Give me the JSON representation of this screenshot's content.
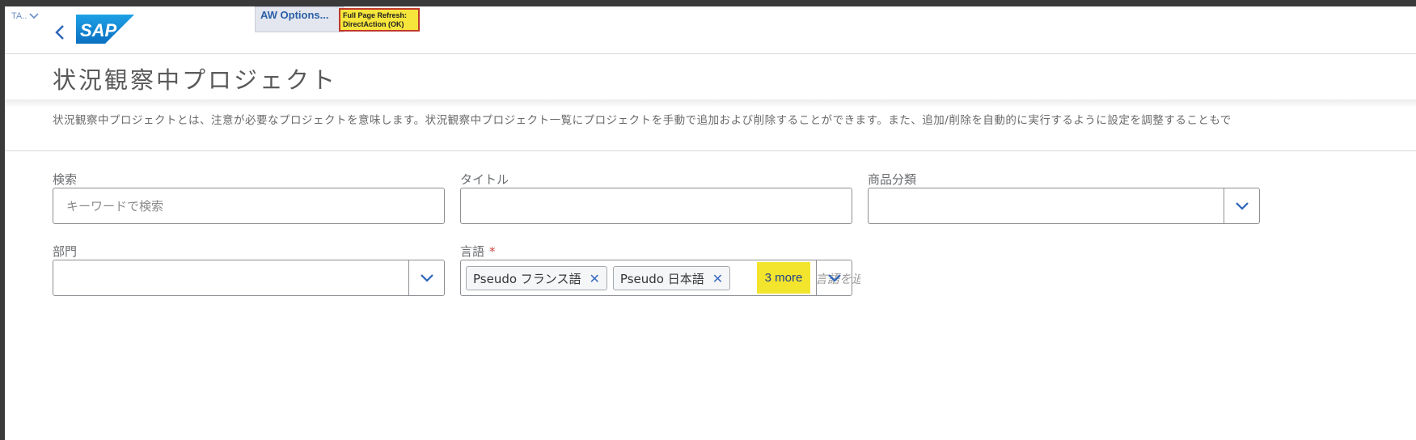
{
  "header": {
    "ta_menu_label": "TA..",
    "aw_options_label": "AW Options...",
    "refresh_badge_line1": "Full Page Refresh:",
    "refresh_badge_line2": "DirectAction (OK)",
    "logo_text": "SAP"
  },
  "page": {
    "title": "状況観察中プロジェクト",
    "description": "状況観察中プロジェクトとは、注意が必要なプロジェクトを意味します。状況観察中プロジェクト一覧にプロジェクトを手動で追加および削除することができます。また、追加/削除を自動的に実行するように設定を調整することもで"
  },
  "form": {
    "search": {
      "label": "検索",
      "placeholder": "キーワードで検索",
      "value": ""
    },
    "title": {
      "label": "タイトル",
      "value": ""
    },
    "product_category": {
      "label": "商品分類",
      "value": ""
    },
    "department": {
      "label": "部門",
      "value": ""
    },
    "language": {
      "label": "言語",
      "required_marker": "*",
      "tokens": [
        {
          "text": "Pseudo フランス語",
          "remove": "✕"
        },
        {
          "text": "Pseudo 日本語",
          "remove": "✕"
        }
      ],
      "more": "3 more",
      "placeholder": "言語を追"
    }
  },
  "colors": {
    "accent": "#3b6bc2",
    "highlight": "#f3e52d",
    "required": "#d04343"
  }
}
